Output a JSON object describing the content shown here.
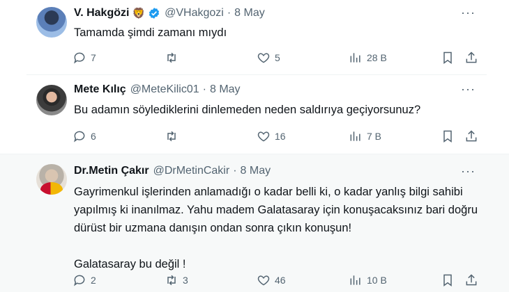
{
  "tweets": [
    {
      "name": "V. Hakgözi",
      "emoji": "🦁",
      "verified": true,
      "handle": "@VHakgozi",
      "separator": "·",
      "date": "8 May",
      "text": [
        "Tamamda şimdi zamanı mıydı"
      ],
      "replies": "7",
      "retweets": "",
      "likes": "5",
      "views": "28 B"
    },
    {
      "name": "Mete Kılıç",
      "handle": "@MeteKilic01",
      "separator": "·",
      "date": "8 May",
      "text": [
        "Bu adamın söylediklerini dinlemeden neden saldırıya geçiyorsunuz?"
      ],
      "replies": "6",
      "retweets": "",
      "likes": "16",
      "views": "7 B"
    },
    {
      "name": "Dr.Metin Çakır",
      "handle": "@DrMetinCakir",
      "separator": "·",
      "date": "8 May",
      "text": [
        "Gayrimenkul işlerinden anlamadığı o kadar belli ki, o kadar yanlış bilgi sahibi yapılmış ki inanılmaz. Yahu madem Galatasaray için konuşacaksınız bari doğru dürüst bir uzmana danışın ondan sonra çıkın konuşun!",
        "Galatasaray bu değil !"
      ],
      "replies": "2",
      "retweets": "3",
      "likes": "46",
      "views": "10 B"
    }
  ],
  "more_glyph": "···",
  "colors": {
    "text": "#0f1419",
    "muted": "#536471",
    "verified": "#1d9bf0",
    "divider": "#eff3f4",
    "highlight": "#f7f9f9"
  },
  "icons": [
    "reply-icon",
    "retweet-icon",
    "like-icon",
    "views-icon",
    "bookmark-icon",
    "share-icon",
    "more-icon",
    "verified-badge-icon"
  ]
}
